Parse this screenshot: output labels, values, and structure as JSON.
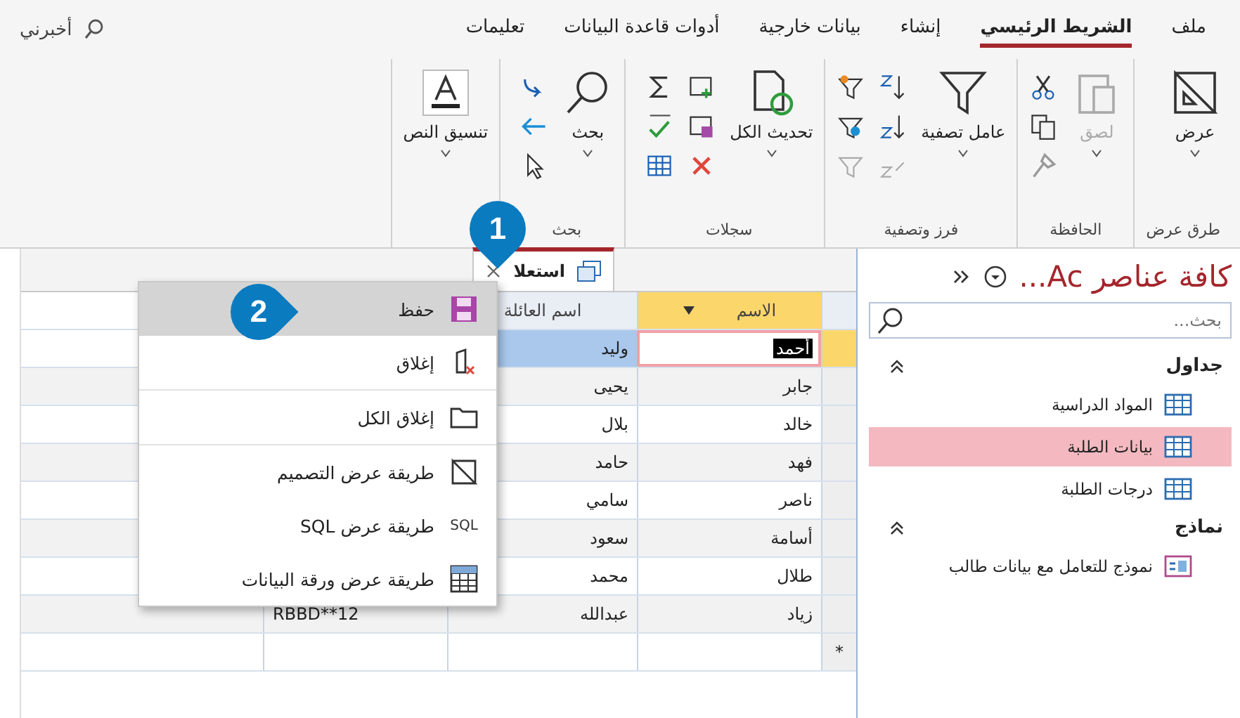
{
  "ribbon_tabs": [
    {
      "label": "ملف",
      "selected": false
    },
    {
      "label": "الشريط الرئيسي",
      "selected": true
    },
    {
      "label": "إنشاء",
      "selected": false
    },
    {
      "label": "بيانات خارجية",
      "selected": false
    },
    {
      "label": "أدوات قاعدة البيانات",
      "selected": false
    },
    {
      "label": "تعليمات",
      "selected": false
    }
  ],
  "tell_me": "أخبرني",
  "ribbon_groups": [
    {
      "kind": "views",
      "label": "طرق عرض",
      "buttons": [
        {
          "label": "عرض",
          "disabled": false
        }
      ]
    },
    {
      "kind": "clipboard",
      "label": "الحافظة",
      "buttons": [
        {
          "label": "لصق",
          "disabled": true
        }
      ]
    },
    {
      "kind": "sort_filter",
      "label": "فرز وتصفية",
      "buttons": [
        {
          "label": "عامل تصفية",
          "disabled": false
        }
      ]
    },
    {
      "kind": "records",
      "label": "سجلات",
      "buttons": [
        {
          "label": "تحديث الكل",
          "disabled": false
        }
      ]
    },
    {
      "kind": "find",
      "label": "بحث",
      "buttons": [
        {
          "label": "بحث",
          "disabled": false
        }
      ]
    },
    {
      "kind": "text_format",
      "buttons": [
        {
          "label": "تنسيق النص",
          "disabled": false
        }
      ]
    }
  ],
  "document_tab": {
    "title": "استعلا"
  },
  "datasheet": {
    "columns": [
      {
        "label": "الاسم",
        "selected": true
      },
      {
        "label": "اسم العائلة",
        "selected": false
      }
    ],
    "rows": [
      {
        "cells": [
          "أحمد",
          "وليد"
        ],
        "selected": true
      },
      {
        "cells": [
          "جابر",
          "يحيى"
        ],
        "selected": false
      },
      {
        "cells": [
          "خالد",
          "بلال"
        ],
        "selected": false
      },
      {
        "cells": [
          "فهد",
          "حامد"
        ],
        "selected": false
      },
      {
        "cells": [
          "ناصر",
          "سامي"
        ],
        "selected": false
      },
      {
        "cells": [
          "أسامة",
          "سعود"
        ],
        "selected": false
      },
      {
        "cells": [
          "طلال",
          "محمد"
        ],
        "selected": false
      },
      {
        "cells": [
          "زياد",
          "عبدالله"
        ],
        "selected": false,
        "column_3": "RBBD**12"
      }
    ],
    "new_row_marker": "*"
  },
  "context_menu": [
    {
      "kind": "save",
      "label": "حفظ",
      "selected": true
    },
    {
      "kind": "close",
      "label": "إغلاق",
      "selected": false
    },
    {
      "kind": "close_all",
      "label": "إغلاق الكل",
      "selected": false
    },
    {
      "kind": "design",
      "label": "طريقة عرض التصميم",
      "selected": false
    },
    {
      "kind": "sql",
      "label": "طريقة عرض SQL",
      "icon_text": "SQL",
      "selected": false
    },
    {
      "kind": "datasheet",
      "label": "طريقة عرض ورقة البيانات",
      "selected": false
    }
  ],
  "nav_pane": {
    "title": "كافة عناصر Ac...",
    "search": {
      "placeholder": "بحث..."
    },
    "groups": [
      {
        "label": "جداول",
        "expanded": true,
        "items": [
          {
            "kind": "table",
            "label": "المواد الدراسية",
            "selected": false
          },
          {
            "kind": "table",
            "label": "بيانات الطلبة",
            "selected": true
          },
          {
            "kind": "table",
            "label": "درجات الطلبة",
            "selected": false
          }
        ]
      },
      {
        "label": "نماذج",
        "expanded": true,
        "items": [
          {
            "kind": "form",
            "label": "نموذج للتعامل مع بيانات طالب",
            "selected": false
          }
        ]
      }
    ]
  },
  "callouts": [
    {
      "number": "1"
    },
    {
      "number": "2"
    }
  ]
}
